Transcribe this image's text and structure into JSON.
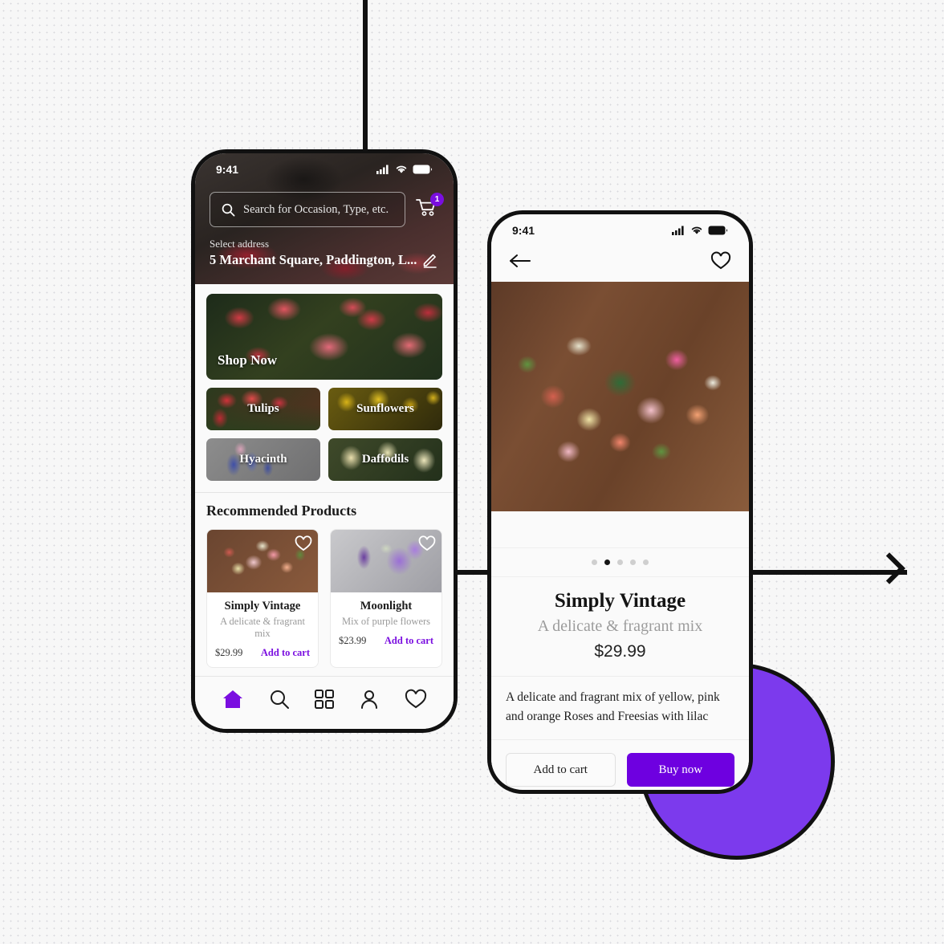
{
  "canvas": {
    "background_color": "#f7f7f7",
    "accent_purple": "#6e00e0",
    "decor_circle_color": "#7c3aed",
    "outline_color": "#111111"
  },
  "phone_home": {
    "status": {
      "time": "9:41",
      "signal_icon": "cellular-signal-icon",
      "wifi_icon": "wifi-icon",
      "battery_icon": "battery-icon"
    },
    "search": {
      "icon": "search-icon",
      "placeholder": "Search for Occasion, Type, etc.",
      "value": ""
    },
    "cart": {
      "icon": "shopping-cart-icon",
      "badge_count": "1"
    },
    "address": {
      "label": "Select address",
      "value": "5 Marchant Square, Paddington, L...",
      "edit_icon": "pencil-edit-icon"
    },
    "hero": {
      "label": "Shop Now"
    },
    "categories": [
      {
        "label": "Tulips"
      },
      {
        "label": "Sunflowers"
      },
      {
        "label": "Hyacinth"
      },
      {
        "label": "Daffodils"
      }
    ],
    "recommended": {
      "section_title": "Recommended Products",
      "products": [
        {
          "name": "Simply Vintage",
          "description": "A delicate & fragrant mix",
          "price": "$29.99",
          "add_label": "Add to cart",
          "favorite_icon": "heart-outline-icon"
        },
        {
          "name": "Moonlight",
          "description": "Mix of purple flowers",
          "price": "$23.99",
          "add_label": "Add to cart",
          "favorite_icon": "heart-outline-icon"
        }
      ]
    },
    "tabbar": [
      {
        "name": "home",
        "icon": "home-icon",
        "active": true
      },
      {
        "name": "search",
        "icon": "search-icon",
        "active": false
      },
      {
        "name": "categories",
        "icon": "grid-icon",
        "active": false
      },
      {
        "name": "account",
        "icon": "person-icon",
        "active": false
      },
      {
        "name": "wishlist",
        "icon": "heart-outline-icon",
        "active": false
      }
    ]
  },
  "phone_detail": {
    "status": {
      "time": "9:41",
      "signal_icon": "cellular-signal-icon",
      "wifi_icon": "wifi-icon",
      "battery_icon": "battery-icon"
    },
    "nav": {
      "back_icon": "arrow-left-icon",
      "favorite_icon": "heart-outline-icon"
    },
    "gallery": {
      "dot_count": 5,
      "active_dot_index": 1
    },
    "product": {
      "title": "Simply Vintage",
      "subtitle": "A delicate & fragrant mix",
      "price": "$29.99",
      "description": "A delicate and fragrant mix of yellow, pink and orange Roses and Freesias with lilac"
    },
    "actions": {
      "add_to_cart_label": "Add to cart",
      "buy_now_label": "Buy now"
    }
  },
  "flow": {
    "arrow_icon": "arrow-right-icon",
    "connector_vertical": "flow-line-vertical",
    "connector_horizontal": "flow-line-horizontal"
  }
}
